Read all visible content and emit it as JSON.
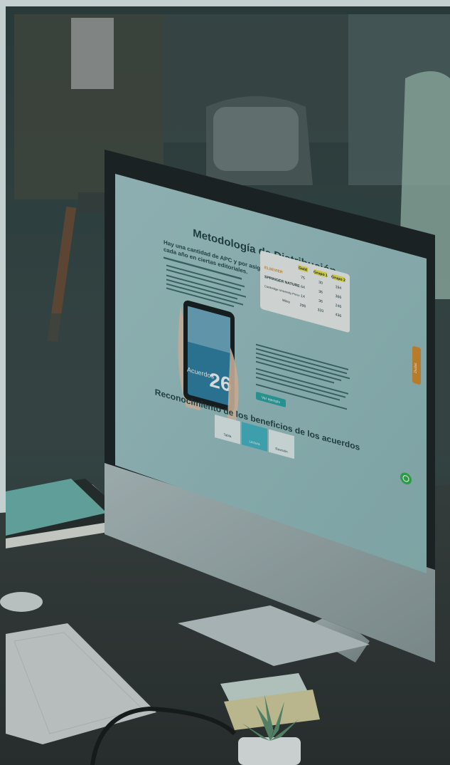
{
  "screen": {
    "heading": "Metodología de Distribución",
    "intro_title_line1": "Hay una cantidad de APC y por asignar",
    "intro_title_line2": "cada año  en ciertas editoriales.",
    "table": {
      "col_headers": [
        "Gold",
        "Grupo 1",
        "Grupo 2"
      ],
      "rows": [
        {
          "publisher": "ELSEVIER",
          "values": [
            "75",
            "30",
            "194"
          ]
        },
        {
          "publisher": "SPRINGER NATURE",
          "values": [
            "64",
            "36",
            "366"
          ]
        },
        {
          "publisher": "Cambridge University Press",
          "values": [
            "14",
            "36",
            "246"
          ]
        },
        {
          "publisher": "Wiley",
          "values": [
            "296",
            "320",
            "436"
          ]
        }
      ]
    },
    "tablet_big_number": "26",
    "tablet_word": "Acuerdos",
    "cta_button": "Ver ejemplo",
    "section_title_line1": "Reconocimiento de los beneficios de los acuerdos",
    "side_tab": "Dudas",
    "tabs": [
      "Tabla",
      "Lectura",
      "Revisión"
    ]
  },
  "colors": {
    "screen_bg": "#9fc3c5",
    "accent_teal": "#2aa7a5",
    "side_tab_orange": "#d98b2b",
    "whatsapp_green": "#2fb34a",
    "overlay_tint": "#2a4a4c"
  },
  "icons": [
    "desk-lamp",
    "whatsapp-icon",
    "plant",
    "keyboard",
    "mouse",
    "glasses"
  ]
}
